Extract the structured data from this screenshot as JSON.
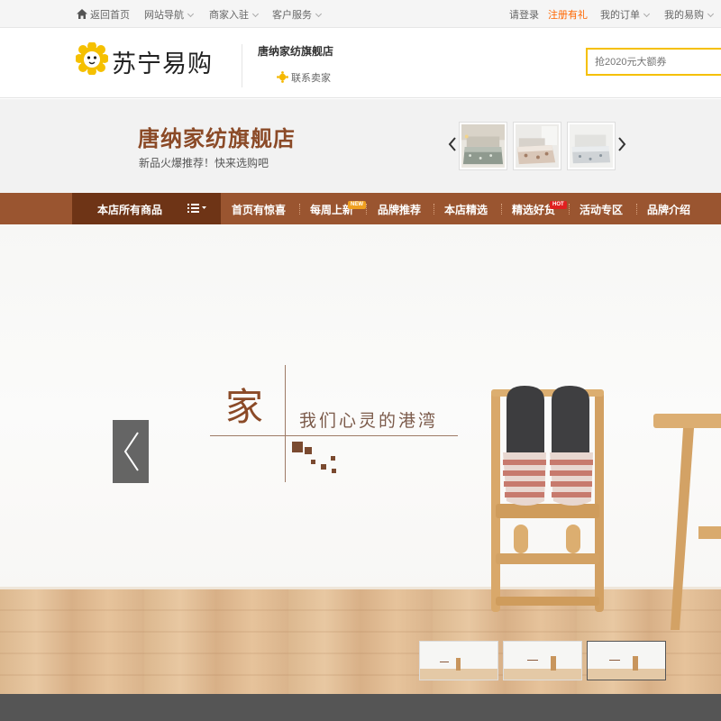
{
  "topbar": {
    "home": "返回首页",
    "site_nav": "网站导航",
    "merchant": "商家入驻",
    "service": "客户服务",
    "login": "请登录",
    "register": "注册有礼",
    "orders": "我的订单",
    "my_account": "我的易购"
  },
  "header": {
    "logo_text": "苏宁易购",
    "shop_name": "唐纳家纺旗舰店",
    "contact": "联系卖家",
    "search_placeholder": "抢2020元大额券"
  },
  "banner": {
    "title": "唐纳家纺旗舰店",
    "slogan": "新品火爆推荐！快来选购吧"
  },
  "nav": {
    "all_products": "本店所有商品",
    "items": [
      {
        "label": "首页有惊喜"
      },
      {
        "label": "每周上新",
        "badge": "NEW"
      },
      {
        "label": "品牌推荐"
      },
      {
        "label": "本店精选"
      },
      {
        "label": "精选好货",
        "badge": "HOT"
      },
      {
        "label": "活动专区"
      },
      {
        "label": "品牌介绍"
      }
    ]
  },
  "hero": {
    "jia": "家",
    "tagline": "我们心灵的港湾"
  },
  "colors": {
    "brand_brown": "#8b4a27",
    "nav_bg": "#9a5530",
    "nav_dark": "#6e3416",
    "search_border": "#f5c000",
    "orange": "#ff6600"
  }
}
